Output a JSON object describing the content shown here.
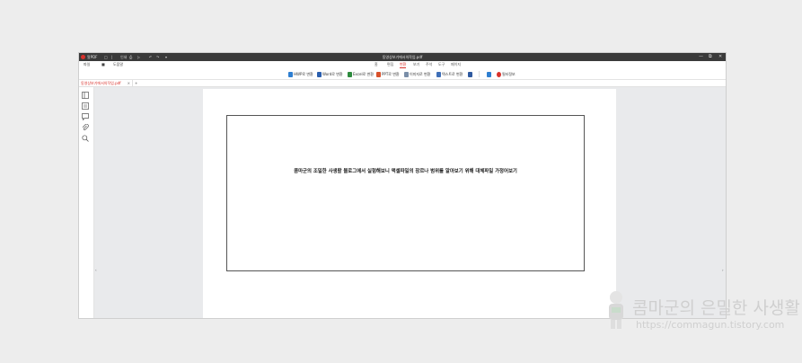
{
  "app": {
    "name": "알PDF",
    "window_title": "동영상보기에서의작업.pdf",
    "quick_actions": [
      "□",
      "|",
      "인쇄",
      "⎙",
      "▷",
      "↶",
      "↷",
      "▾"
    ],
    "window_controls": [
      "—",
      "⧉",
      "✕"
    ]
  },
  "menu": {
    "left_items": [
      "파일",
      "■",
      "도움말"
    ],
    "tabs": [
      "홈",
      "편집",
      "변환",
      "보기",
      "주석",
      "도구",
      "페이지"
    ],
    "active_tab": "변환"
  },
  "ribbon": {
    "buttons": [
      {
        "label": "HWP로 변환",
        "color": "#2f7fd1"
      },
      {
        "label": "Word로 변환",
        "color": "#2b5fae"
      },
      {
        "label": "Excel로 변환",
        "color": "#2e8b3e"
      },
      {
        "label": "PPT로 변환",
        "color": "#d8512b"
      },
      {
        "label": "이미지로 변환",
        "color": "#7a8ea8"
      },
      {
        "label": "텍스트로 변환",
        "color": "#3f6fb8"
      },
      {
        "label": "",
        "color": "#2f5aa0"
      },
      {
        "label": "",
        "color": "#2f7fd1"
      },
      {
        "label": "필터정보",
        "color": "#d9312b"
      }
    ]
  },
  "document_tab": {
    "name": "동영상보기에서의작업.pdf",
    "close": "×",
    "new_tab": "+"
  },
  "sidebar": {
    "icons": [
      "thumbnails-icon",
      "bookmarks-icon",
      "comments-icon",
      "attachments-icon",
      "search-icon"
    ]
  },
  "document": {
    "body_text": "콤마군의 조밀한 사생활 블로그에서 실험해보니 액셀파일의 장르나 범위를 알아보기 위해 대체파일 가정어보기"
  },
  "viewer": {
    "left_arrow": "‹",
    "right_arrow": "›"
  },
  "watermark": {
    "title": "콤마군의 은밀한 사생활",
    "url": "https://commagun.tistory.com"
  },
  "colors": {
    "accent": "#d9312b",
    "titlebar": "#3a3a3a",
    "viewer_bg": "#e9eaec"
  }
}
